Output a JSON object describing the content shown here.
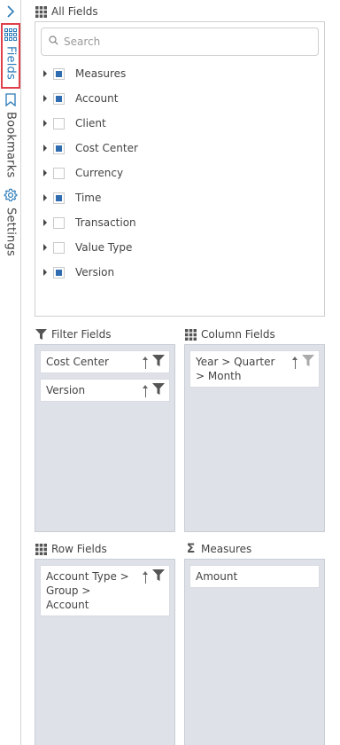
{
  "rail": {
    "tabs": [
      {
        "label": "Fields",
        "icon": "grid-icon",
        "active": true
      },
      {
        "label": "Bookmarks",
        "icon": "bookmark-icon",
        "active": false
      },
      {
        "label": "Settings",
        "icon": "gear-icon",
        "active": false
      }
    ]
  },
  "all_fields": {
    "title": "All Fields",
    "search_placeholder": "Search",
    "items": [
      {
        "label": "Measures",
        "checked": true
      },
      {
        "label": "Account",
        "checked": true
      },
      {
        "label": "Client",
        "checked": false
      },
      {
        "label": "Cost Center",
        "checked": true
      },
      {
        "label": "Currency",
        "checked": false
      },
      {
        "label": "Time",
        "checked": true
      },
      {
        "label": "Transaction",
        "checked": false
      },
      {
        "label": "Value Type",
        "checked": false
      },
      {
        "label": "Version",
        "checked": true
      }
    ]
  },
  "filter_fields": {
    "title": "Filter Fields",
    "items": [
      "Cost Center",
      "Version"
    ]
  },
  "column_fields": {
    "title": "Column Fields",
    "items": [
      "Year > Quarter > Month"
    ]
  },
  "row_fields": {
    "title": "Row Fields",
    "items": [
      "Account Type > Group > Account"
    ]
  },
  "measures": {
    "title": "Measures",
    "items": [
      "Amount"
    ]
  },
  "colors": {
    "accent": "#2a7ab8",
    "checkbox_fill": "#2f6db0",
    "highlight_border": "#e0404a",
    "zone_bg": "#dee1e8"
  }
}
